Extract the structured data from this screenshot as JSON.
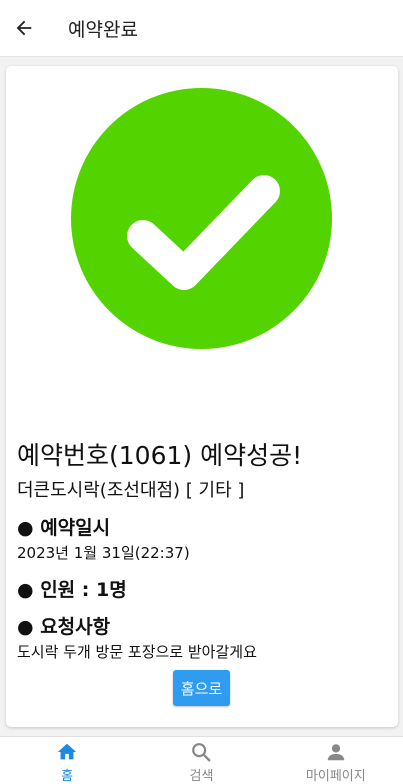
{
  "app_bar": {
    "title": "예약완료"
  },
  "result": {
    "title": "예약번호(1061) 예약성공!",
    "store": "더큰도시락(조선대점) [ 기타 ]"
  },
  "details": {
    "datetime_heading": "● 예약일시",
    "datetime_value": "2023년 1월 31일(22:37)",
    "people_heading": "● 인원 : 1명",
    "request_heading": "● 요청사항",
    "request_value": "도시락 두개 방문 포장으로 받아갈게요"
  },
  "home_button_label": "홈으로",
  "bottom_nav": {
    "items": [
      {
        "label": "홈",
        "icon": "home-icon",
        "active": true
      },
      {
        "label": "검색",
        "icon": "search-icon",
        "active": false
      },
      {
        "label": "마이페이지",
        "icon": "person-icon",
        "active": false
      }
    ]
  },
  "colors": {
    "success_green": "#53d400",
    "accent_blue": "#1e88e5",
    "button_blue": "#2f9cf0"
  }
}
